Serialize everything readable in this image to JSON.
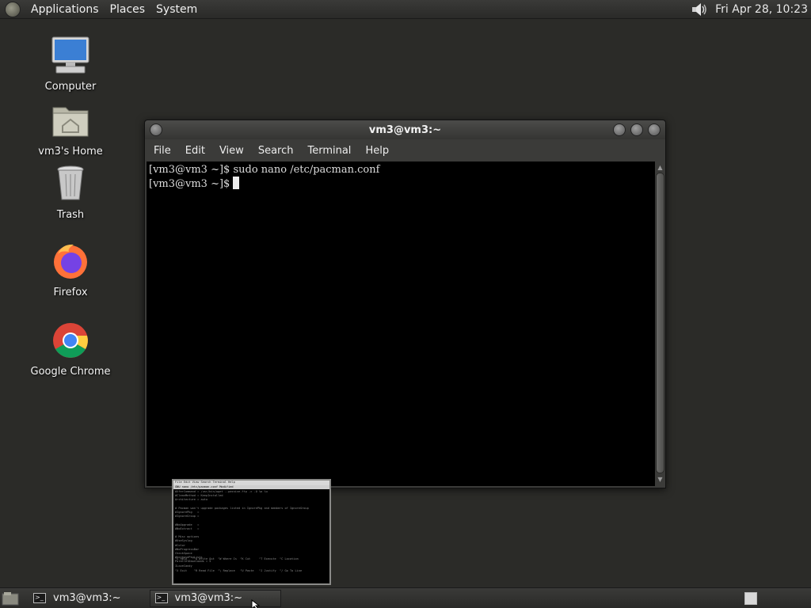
{
  "top_panel": {
    "menus": [
      "Applications",
      "Places",
      "System"
    ],
    "clock": "Fri Apr 28, 10:23"
  },
  "desktop_icons": [
    {
      "label": "Computer",
      "icon": "computer-icon"
    },
    {
      "label": "vm3's Home",
      "icon": "home-folder-icon"
    },
    {
      "label": "Trash",
      "icon": "trash-icon"
    },
    {
      "label": "Firefox",
      "icon": "firefox-icon"
    },
    {
      "label": "Google Chrome",
      "icon": "chrome-icon"
    }
  ],
  "window": {
    "title": "vm3@vm3:~",
    "menu": [
      "File",
      "Edit",
      "View",
      "Search",
      "Terminal",
      "Help"
    ],
    "terminal_lines": [
      "[vm3@vm3 ~]$ sudo nano /etc/pacman.conf",
      "[vm3@vm3 ~]$ "
    ]
  },
  "preview": {
    "menu": "File  Edit  View  Search  Terminal  Help",
    "title": "GNU nano                 /etc/pacman.conf                Modified",
    "lines": [
      "#XferCommand = /usr/bin/wget --passive-ftp -c -O %o %u",
      "#CleanMethod = KeepInstalled",
      "Architecture = auto",
      "",
      "# Pacman won't upgrade packages listed in IgnorePkg and members of IgnoreGroup",
      "#IgnorePkg   =",
      "#IgnoreGroup =",
      "",
      "#NoUpgrade   =",
      "#NoExtract   =",
      "",
      "# Misc options",
      "#UseSyslog",
      "#Color",
      "#NoProgressBar",
      "CheckSpace",
      "#VerbosePkgLists",
      "ParallelDownloads = 5",
      "ILoveCandy"
    ],
    "footer": [
      "^G Help    ^O Write Out  ^W Where Is  ^K Cut     ^T Execute  ^C Location",
      "^X Exit    ^R Read File  ^\\ Replace   ^U Paste   ^J Justify  ^/ Go To Line"
    ]
  },
  "bottom_panel": {
    "tasks": [
      {
        "label": "vm3@vm3:~",
        "active": false
      },
      {
        "label": "vm3@vm3:~",
        "active": true
      }
    ]
  }
}
